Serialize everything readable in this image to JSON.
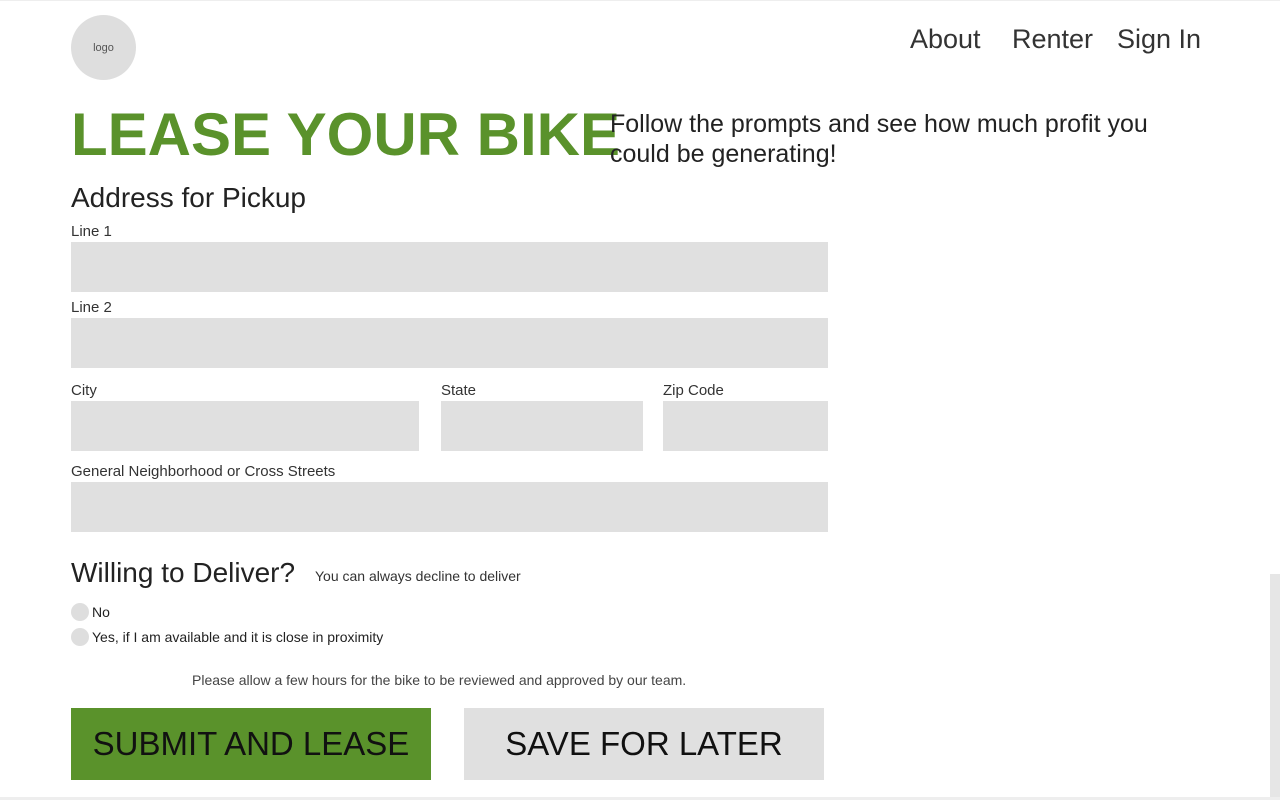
{
  "header": {
    "logo_text": "logo",
    "nav": {
      "about": "About",
      "renter": "Renter",
      "sign_in": "Sign In"
    }
  },
  "hero": {
    "title": "LEASE YOUR BIKE",
    "subtitle": "Follow the prompts and see how much profit you could be generating!"
  },
  "address_form": {
    "heading": "Address for Pickup",
    "line1_label": "Line 1",
    "line1_value": "",
    "line2_label": "Line 2",
    "line2_value": "",
    "city_label": "City",
    "city_value": "",
    "state_label": "State",
    "state_value": "",
    "zip_label": "Zip Code",
    "zip_value": "",
    "neighborhood_label": "General Neighborhood or Cross Streets",
    "neighborhood_value": ""
  },
  "delivery": {
    "heading": "Willing to Deliver?",
    "note": "You can always decline to deliver",
    "options": [
      {
        "label": "No",
        "selected": false
      },
      {
        "label": "Yes, if I am available and it is close in proximity",
        "selected": false
      }
    ]
  },
  "approval_note": "Please allow a few hours for the bike to be reviewed and approved by our team.",
  "actions": {
    "submit_label": "SUBMIT AND LEASE",
    "save_label": "SAVE FOR LATER"
  },
  "colors": {
    "brand_green": "#5a922b",
    "input_gray": "#e0e0e0",
    "radio_gray": "#dedede"
  }
}
